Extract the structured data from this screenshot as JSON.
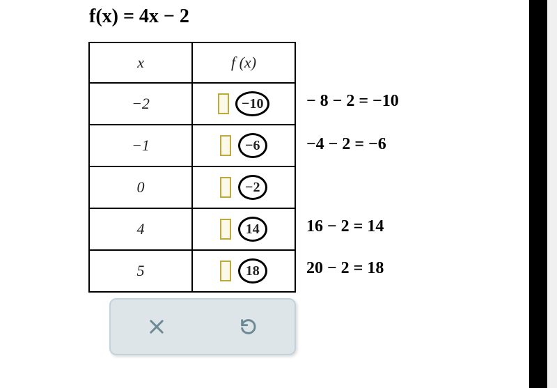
{
  "formula": "f(x) = 4x − 2",
  "table": {
    "headers": {
      "x": "x",
      "fx": "f (x)"
    },
    "rows": [
      {
        "x": "−2",
        "answer": "−10",
        "calc": "− 8 − 2 = −10"
      },
      {
        "x": "−1",
        "answer": "−6",
        "calc": "−4 − 2 = −6"
      },
      {
        "x": "0",
        "answer": "−2",
        "calc": ""
      },
      {
        "x": "4",
        "answer": "14",
        "calc": "16 − 2 = 14"
      },
      {
        "x": "5",
        "answer": "18",
        "calc": "20 − 2 = 18"
      }
    ]
  },
  "toolbar": {
    "close": "close",
    "undo": "undo"
  }
}
